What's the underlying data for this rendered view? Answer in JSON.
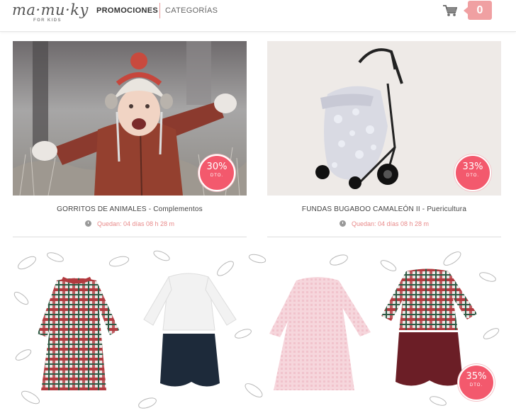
{
  "header": {
    "logo_text": "ma·mu·ky",
    "logo_subtitle": "FOR KIDS",
    "nav": [
      "PROMOCIONES",
      "CATEGORÍAS"
    ],
    "cart_count": "0"
  },
  "promos": [
    {
      "title": "GORRITOS DE ANIMALES",
      "category": " - Complementos",
      "timer": "Quedan: 04 días 08 h 28 m",
      "discount": "30%",
      "discount_label": "DTO."
    },
    {
      "title": "FUNDAS BUGABOO CAMALEÓN II",
      "category": " - Puericultura",
      "timer": "Quedan: 04 días 08 h 28 m",
      "discount": "33%",
      "discount_label": "DTO."
    },
    {
      "discount": "35%",
      "discount_label": "DTO."
    }
  ],
  "icons": {
    "cart": "shopping-cart-icon",
    "clock": "clock-icon"
  },
  "colors": {
    "accent": "#f0a0a2",
    "badge": "#f3596d",
    "timer": "#e88a8a"
  }
}
